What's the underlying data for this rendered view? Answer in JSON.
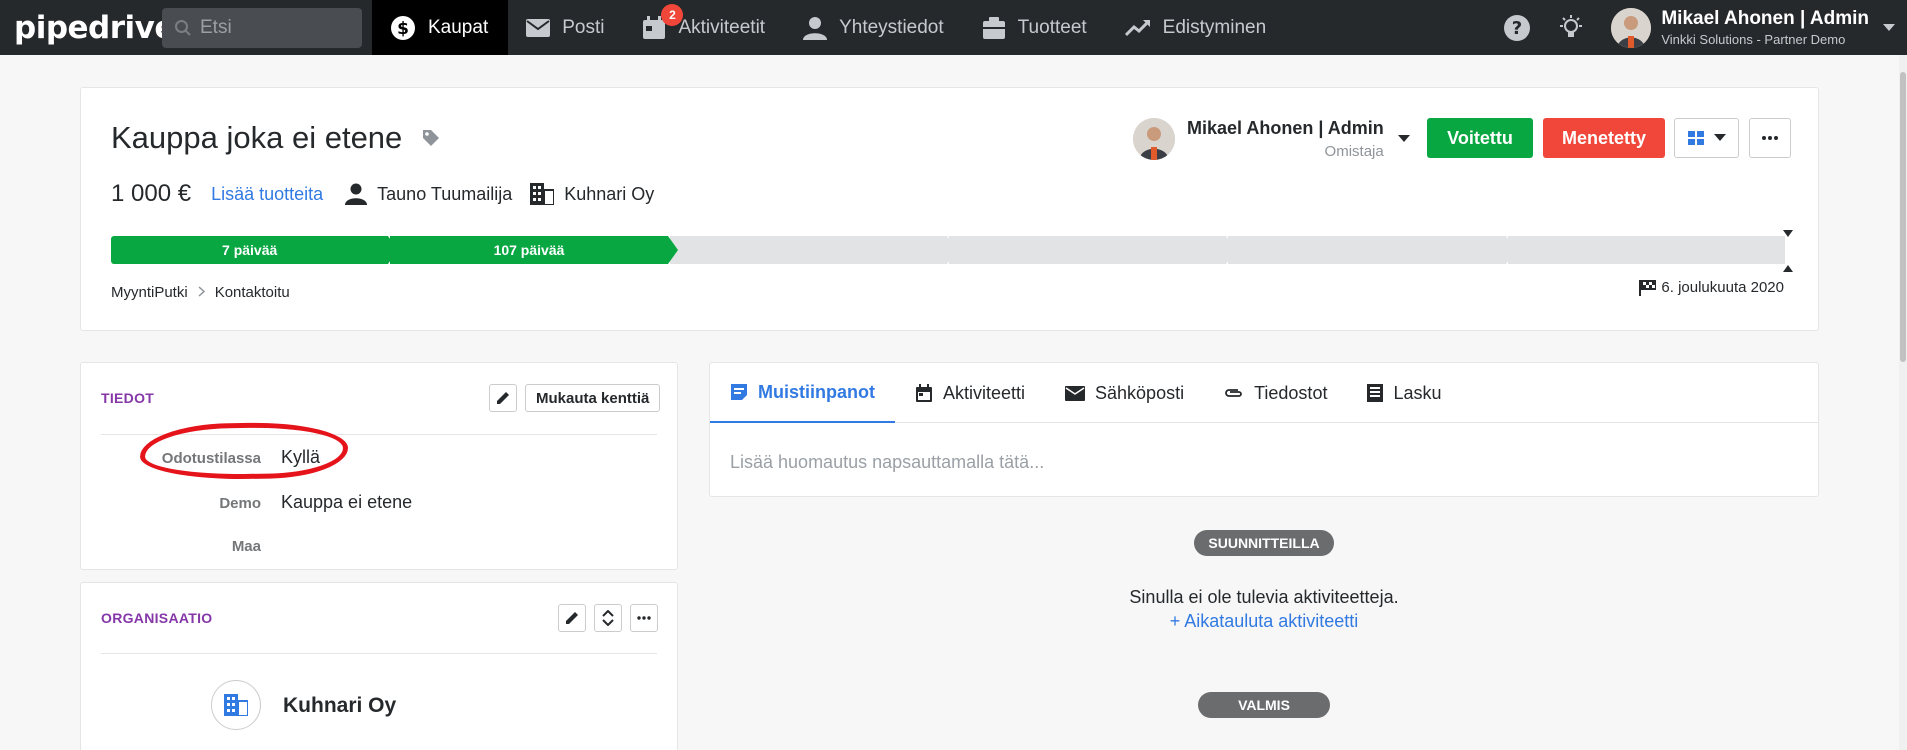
{
  "nav": {
    "logo": "pipedrive",
    "search_placeholder": "Etsi",
    "items": [
      {
        "label": "Kaupat",
        "icon": "dollar-circle-icon",
        "active": true
      },
      {
        "label": "Posti",
        "icon": "mail-icon"
      },
      {
        "label": "Aktiviteetit",
        "icon": "calendar-icon",
        "badge": "2"
      },
      {
        "label": "Yhteystiedot",
        "icon": "person-icon"
      },
      {
        "label": "Tuotteet",
        "icon": "box-icon"
      },
      {
        "label": "Edistyminen",
        "icon": "trend-icon"
      }
    ],
    "user_name": "Mikael Ahonen | Admin",
    "user_company": "Vinkki Solutions - Partner Demo"
  },
  "deal": {
    "title": "Kauppa joka ei etene",
    "amount": "1 000 €",
    "add_products": "Lisää tuotteita",
    "person": "Tauno Tuumailija",
    "organization": "Kuhnari Oy",
    "owner_name": "Mikael Ahonen | Admin",
    "owner_role": "Omistaja",
    "won_label": "Voitettu",
    "lost_label": "Menetetty",
    "stages": [
      "7 päivää",
      "107 päivää",
      "",
      "",
      "",
      ""
    ],
    "stages_completed": 2,
    "pipeline": "MyyntiPutki",
    "current_stage": "Kontaktoitu",
    "expected_close": "6. joulukuuta 2020"
  },
  "details": {
    "title": "TIEDOT",
    "customize_label": "Mukauta kenttiä",
    "fields": [
      {
        "label": "Odotustilassa",
        "value": "Kyllä"
      },
      {
        "label": "Demo",
        "value": "Kauppa ei etene"
      },
      {
        "label": "Maa",
        "value": ""
      }
    ]
  },
  "organization": {
    "title": "ORGANISAATIO",
    "name": "Kuhnari Oy"
  },
  "tabs": {
    "items": [
      {
        "label": "Muistiinpanot",
        "icon": "note-icon",
        "active": true
      },
      {
        "label": "Aktiviteetti",
        "icon": "calendar-icon"
      },
      {
        "label": "Sähköposti",
        "icon": "mail-icon"
      },
      {
        "label": "Tiedostot",
        "icon": "paperclip-icon"
      },
      {
        "label": "Lasku",
        "icon": "invoice-icon"
      }
    ],
    "note_placeholder": "Lisää huomautus napsauttamalla tätä..."
  },
  "timeline": {
    "planned_label": "SUUNNITTEILLA",
    "empty_text": "Sinulla ei ole tulevia aktiviteetteja.",
    "schedule_link": "+ Aikatauluta aktiviteetti",
    "done_label": "VALMIS"
  },
  "colors": {
    "nav_bg": "#26292c",
    "won": "#08a742",
    "lost": "#f0473a",
    "link": "#317ae2",
    "section_title": "#8537a8",
    "annotation_ring": "#e5141b"
  }
}
